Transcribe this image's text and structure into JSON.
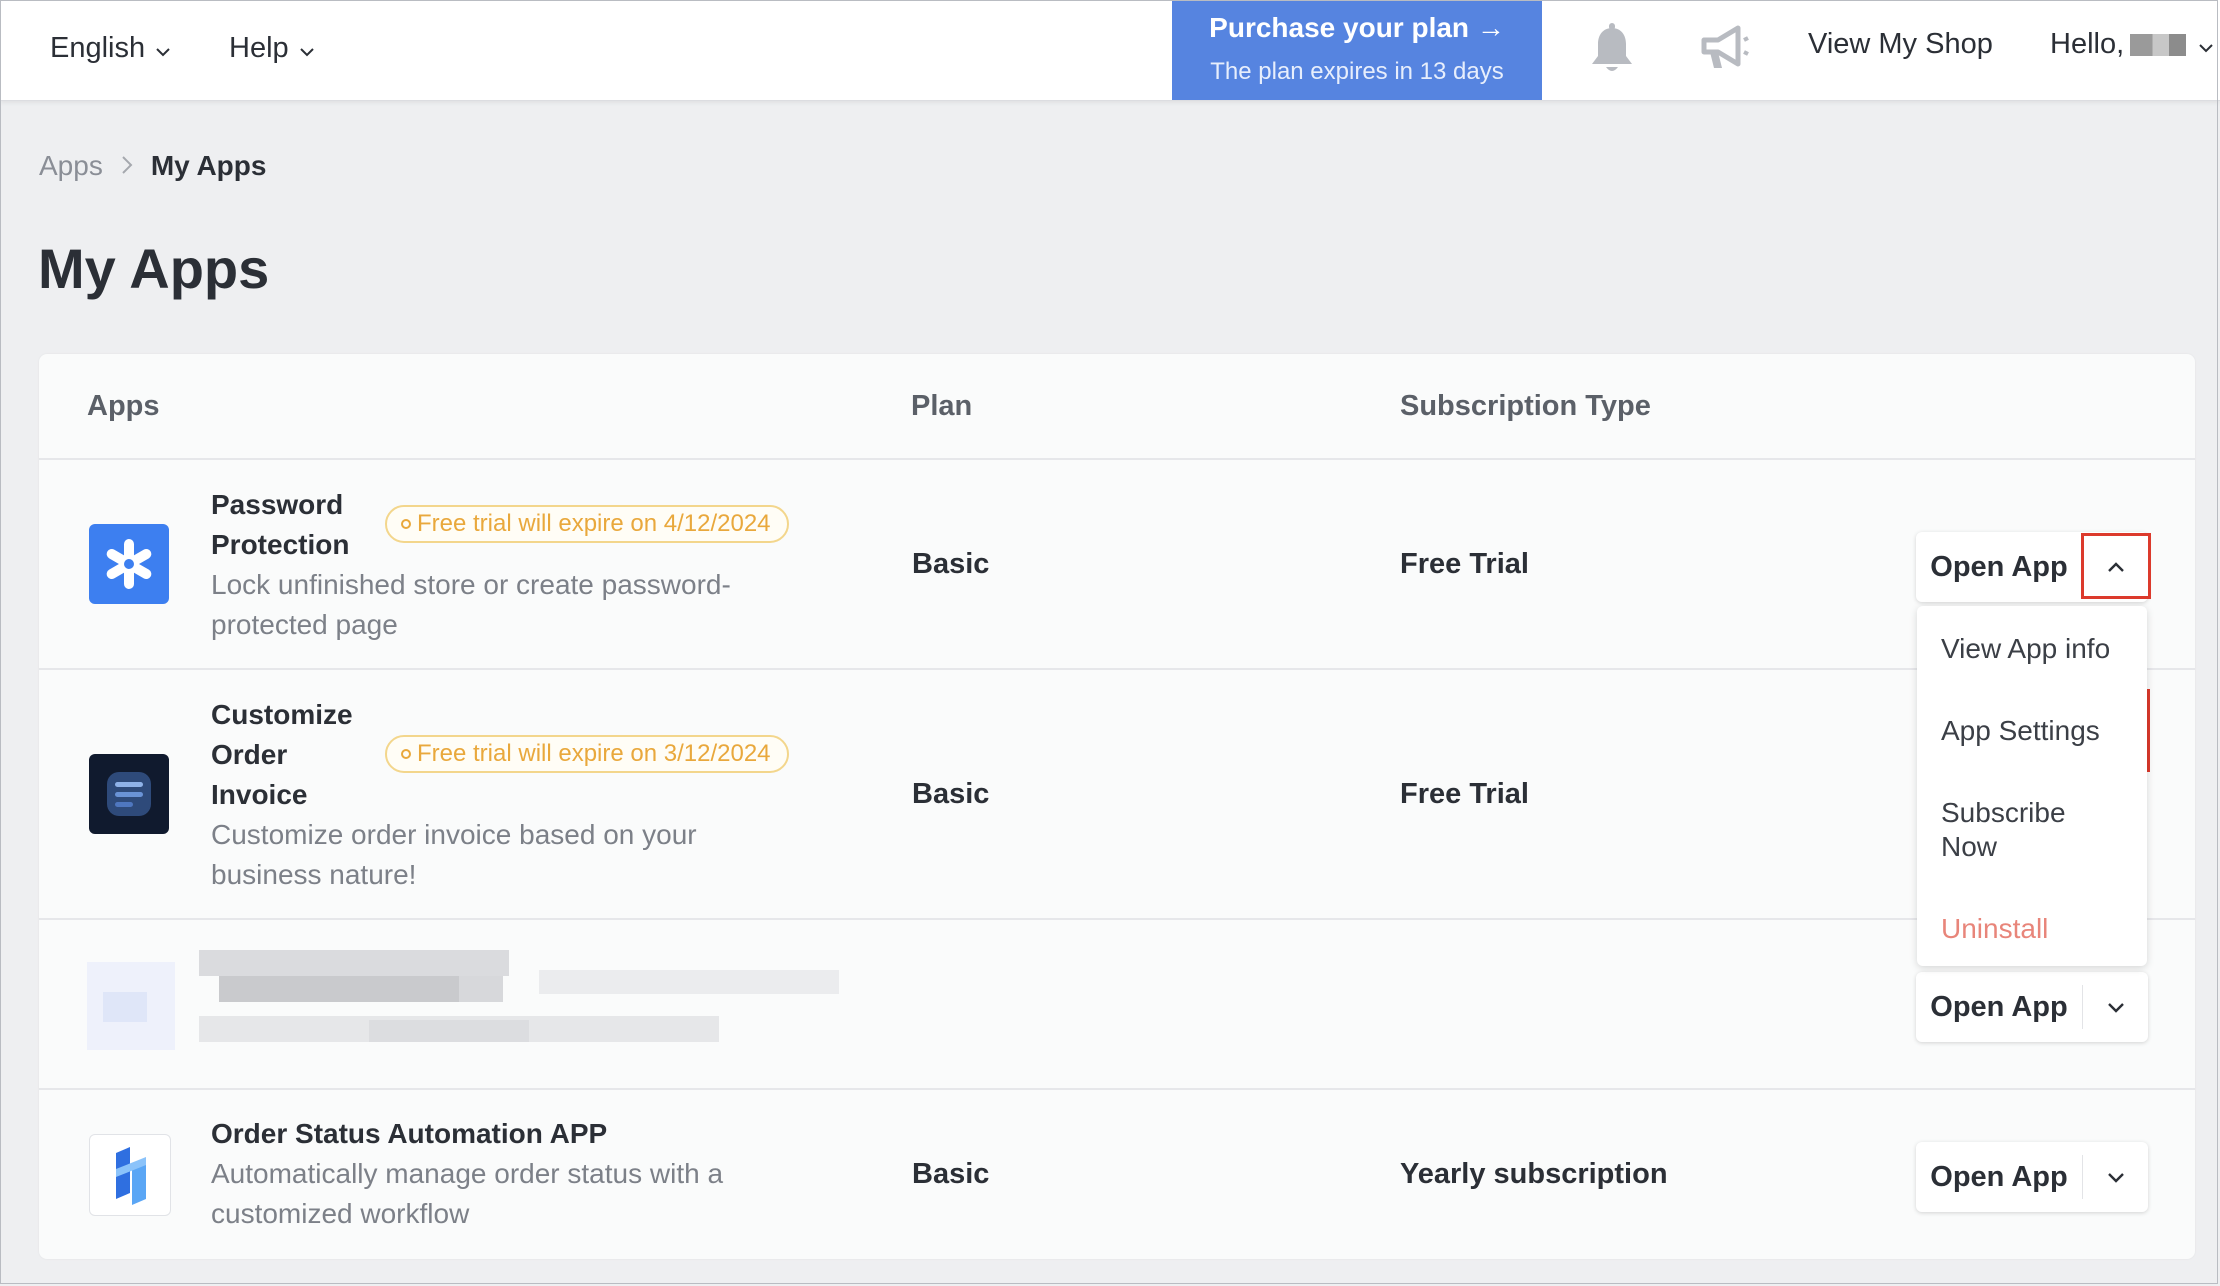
{
  "topbar": {
    "language": "English",
    "help": "Help",
    "purchase_title": "Purchase your plan →",
    "purchase_subtitle": "The plan expires in 13 days",
    "notifications_icon": "bell-icon",
    "announcements_icon": "megaphone-icon",
    "view_shop": "View My Shop",
    "greeting": "Hello,"
  },
  "breadcrumb": {
    "parent": "Apps",
    "current": "My Apps"
  },
  "page_title": "My Apps",
  "table": {
    "headers": {
      "apps": "Apps",
      "plan": "Plan",
      "subscription": "Subscription Type"
    },
    "rows": [
      {
        "name_line1": "Password",
        "name_line2": "Protection",
        "badge": "Free trial will expire on 4/12/2024",
        "desc_line1": "Lock unfinished store or create password-",
        "desc_line2": "protected page",
        "plan": "Basic",
        "subscription": "Free Trial",
        "open": "Open App",
        "icon": "asterisk-icon",
        "icon_color": "#3d7ff0"
      },
      {
        "name_line1": "Customize",
        "name_line2": "Order",
        "name_line3": "Invoice",
        "badge": "Free trial will expire on 3/12/2024",
        "desc_line1": "Customize order invoice based on your",
        "desc_line2": "business nature!",
        "plan": "Basic",
        "subscription": "Free Trial",
        "icon": "invoice-icon",
        "icon_color": "#101a2e"
      },
      {
        "open": "Open App"
      },
      {
        "name": "Order Status Automation APP",
        "desc_line1": "Automatically manage order status with a",
        "desc_line2": "customized workflow",
        "plan": "Basic",
        "subscription": "Yearly subscription",
        "open": "Open App",
        "icon": "status-flow-icon",
        "icon_color": "#3a8af0"
      }
    ]
  },
  "dropdown": {
    "items": [
      "View App info",
      "App Settings",
      "Subscribe Now",
      "Uninstall"
    ],
    "subscribe_line1": "Subscribe",
    "subscribe_line2": "Now"
  },
  "colors": {
    "accent": "#5684e0",
    "badge_warning": "#e9a83c",
    "highlight": "#dc3a2c",
    "danger": "#e8857a"
  }
}
